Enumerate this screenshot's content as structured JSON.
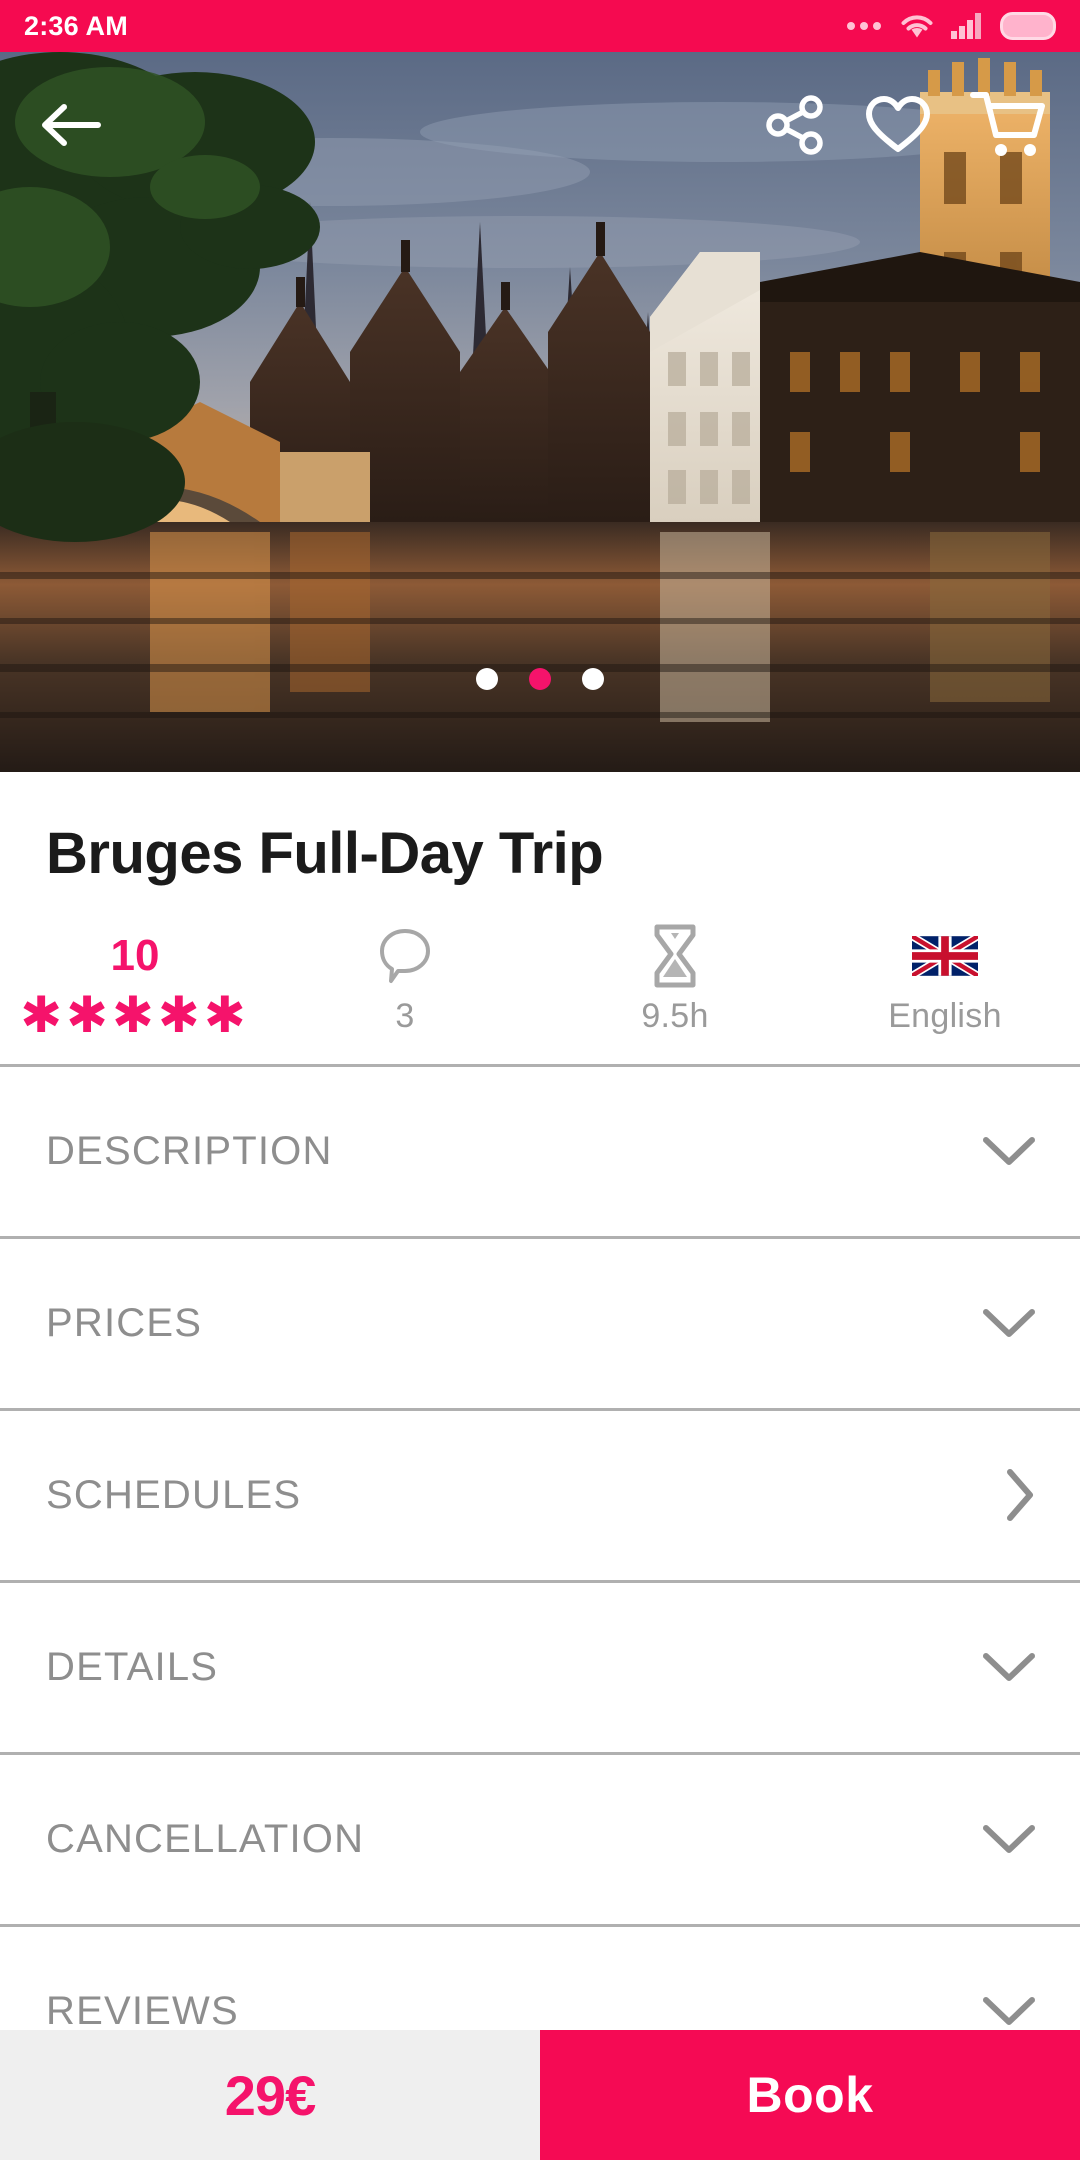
{
  "status_bar": {
    "time": "2:36 AM",
    "icons": [
      "more-dots-icon",
      "wifi-icon",
      "cellular-signal-icon",
      "battery-icon"
    ],
    "background_color": "#f50a50"
  },
  "hero": {
    "image_description": "Bruges canal at dusk with historic brick gabled houses, illuminated belfry tower and tree branches reflected in the water",
    "back_icon": "back-arrow-icon",
    "actions": [
      {
        "name": "share-icon",
        "label": "Share"
      },
      {
        "name": "heart-icon",
        "label": "Favorite"
      },
      {
        "name": "cart-icon",
        "label": "Cart"
      }
    ],
    "carousel": {
      "count": 3,
      "active_index": 1,
      "active_color": "#f5136b",
      "inactive_color": "#ffffff"
    }
  },
  "product": {
    "title": "Bruges Full-Day Trip",
    "info": [
      {
        "key": "rating",
        "icon": "star-rating-icon",
        "value": "10",
        "stars": "✱✱✱✱✱",
        "label": ""
      },
      {
        "key": "reviews",
        "icon": "comment-bubble-icon",
        "value": "",
        "label": "3"
      },
      {
        "key": "duration",
        "icon": "hourglass-icon",
        "value": "",
        "label": "9.5h"
      },
      {
        "key": "language",
        "icon": "uk-flag-icon",
        "value": "",
        "label": "English"
      }
    ]
  },
  "sections": [
    {
      "label": "DESCRIPTION",
      "chevron": "chevron-down-icon"
    },
    {
      "label": "PRICES",
      "chevron": "chevron-down-icon"
    },
    {
      "label": "SCHEDULES",
      "chevron": "chevron-right-icon"
    },
    {
      "label": "DETAILS",
      "chevron": "chevron-down-icon"
    },
    {
      "label": "CANCELLATION",
      "chevron": "chevron-down-icon"
    },
    {
      "label": "REVIEWS",
      "chevron": "chevron-down-icon"
    }
  ],
  "bottom_bar": {
    "price": "29€",
    "book_label": "Book",
    "price_color": "#f5136b",
    "book_background": "#f50a54"
  }
}
